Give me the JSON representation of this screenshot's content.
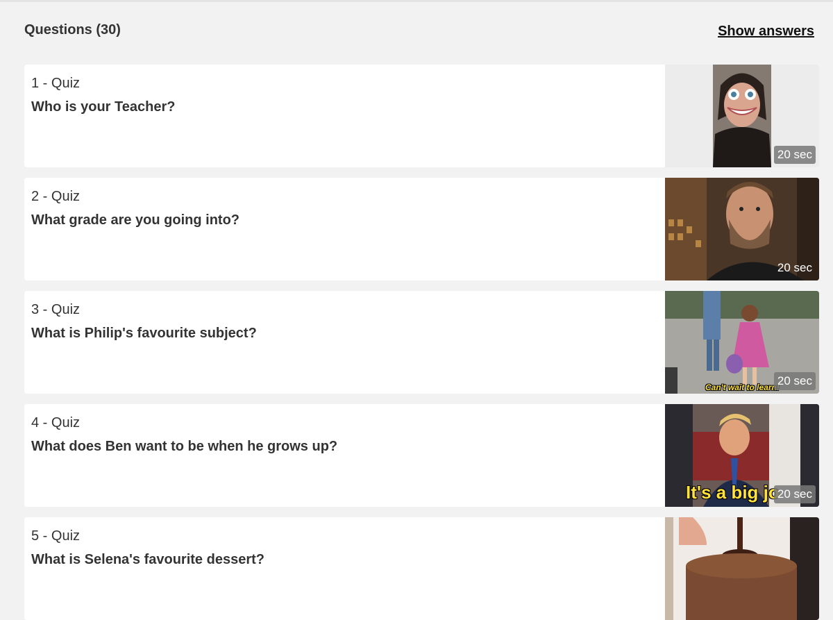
{
  "header": {
    "title": "Questions (30)",
    "show_answers": "Show answers"
  },
  "questions": [
    {
      "label": "1 - Quiz",
      "text": "Who is your Teacher?",
      "time": "20 sec"
    },
    {
      "label": "2 - Quiz",
      "text": "What grade are you going into?",
      "time": "20 sec"
    },
    {
      "label": "3 - Quiz",
      "text": "What is Philip's favourite subject?",
      "time": "20 sec",
      "caption": "Can't wait to learn!"
    },
    {
      "label": "4 - Quiz",
      "text": "What does Ben want to be when he grows up?",
      "time": "20 sec",
      "caption": "It's a big jo"
    },
    {
      "label": "5 - Quiz",
      "text": "What is Selena's favourite dessert?",
      "time": ""
    }
  ],
  "colors": {
    "background": "#f2f2f2",
    "card": "#ffffff",
    "text": "#333333",
    "time_badge": "#7a7a7a"
  }
}
